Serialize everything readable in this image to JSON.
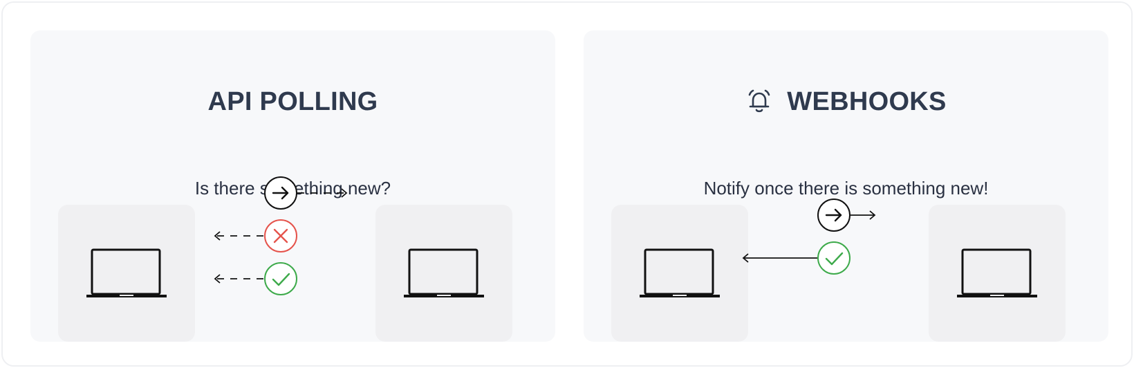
{
  "polling": {
    "title": "API POLLING",
    "subtitle": "Is there something new?"
  },
  "webhooks": {
    "title": "WEBHOOKS",
    "subtitle": "Notify once there is something new!"
  },
  "icons": {
    "bell": "alarm-bell-icon",
    "laptop": "laptop-icon",
    "arrow": "arrow-right-icon",
    "cross": "cross-icon",
    "check": "check-icon"
  },
  "colors": {
    "title": "#2f3a4e",
    "panel": "#f7f8fa",
    "device_box": "#f0f0f2",
    "line": "#111111",
    "error": "#e5534b",
    "success": "#3daa4a"
  }
}
